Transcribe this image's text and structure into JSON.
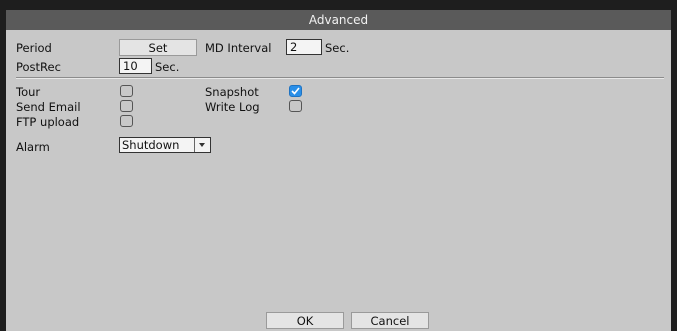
{
  "dialog": {
    "title": "Advanced"
  },
  "period": {
    "label": "Period",
    "button_label": "Set"
  },
  "md_interval": {
    "label": "MD Interval",
    "value": "2",
    "unit": "Sec."
  },
  "postrec": {
    "label": "PostRec",
    "value": "10",
    "unit": "Sec."
  },
  "checks": {
    "tour": {
      "label": "Tour",
      "checked": false
    },
    "snapshot": {
      "label": "Snapshot",
      "checked": true
    },
    "send_email": {
      "label": "Send Email",
      "checked": false
    },
    "write_log": {
      "label": "Write Log",
      "checked": false
    },
    "ftp_upload": {
      "label": "FTP upload",
      "checked": false
    }
  },
  "alarm": {
    "label": "Alarm",
    "selected": "Shutdown"
  },
  "footer": {
    "ok_label": "OK",
    "cancel_label": "Cancel"
  },
  "colors": {
    "titlebar": "#5a5a5a",
    "panel": "#c8c8c8",
    "check_on": "#2a8fe8"
  }
}
